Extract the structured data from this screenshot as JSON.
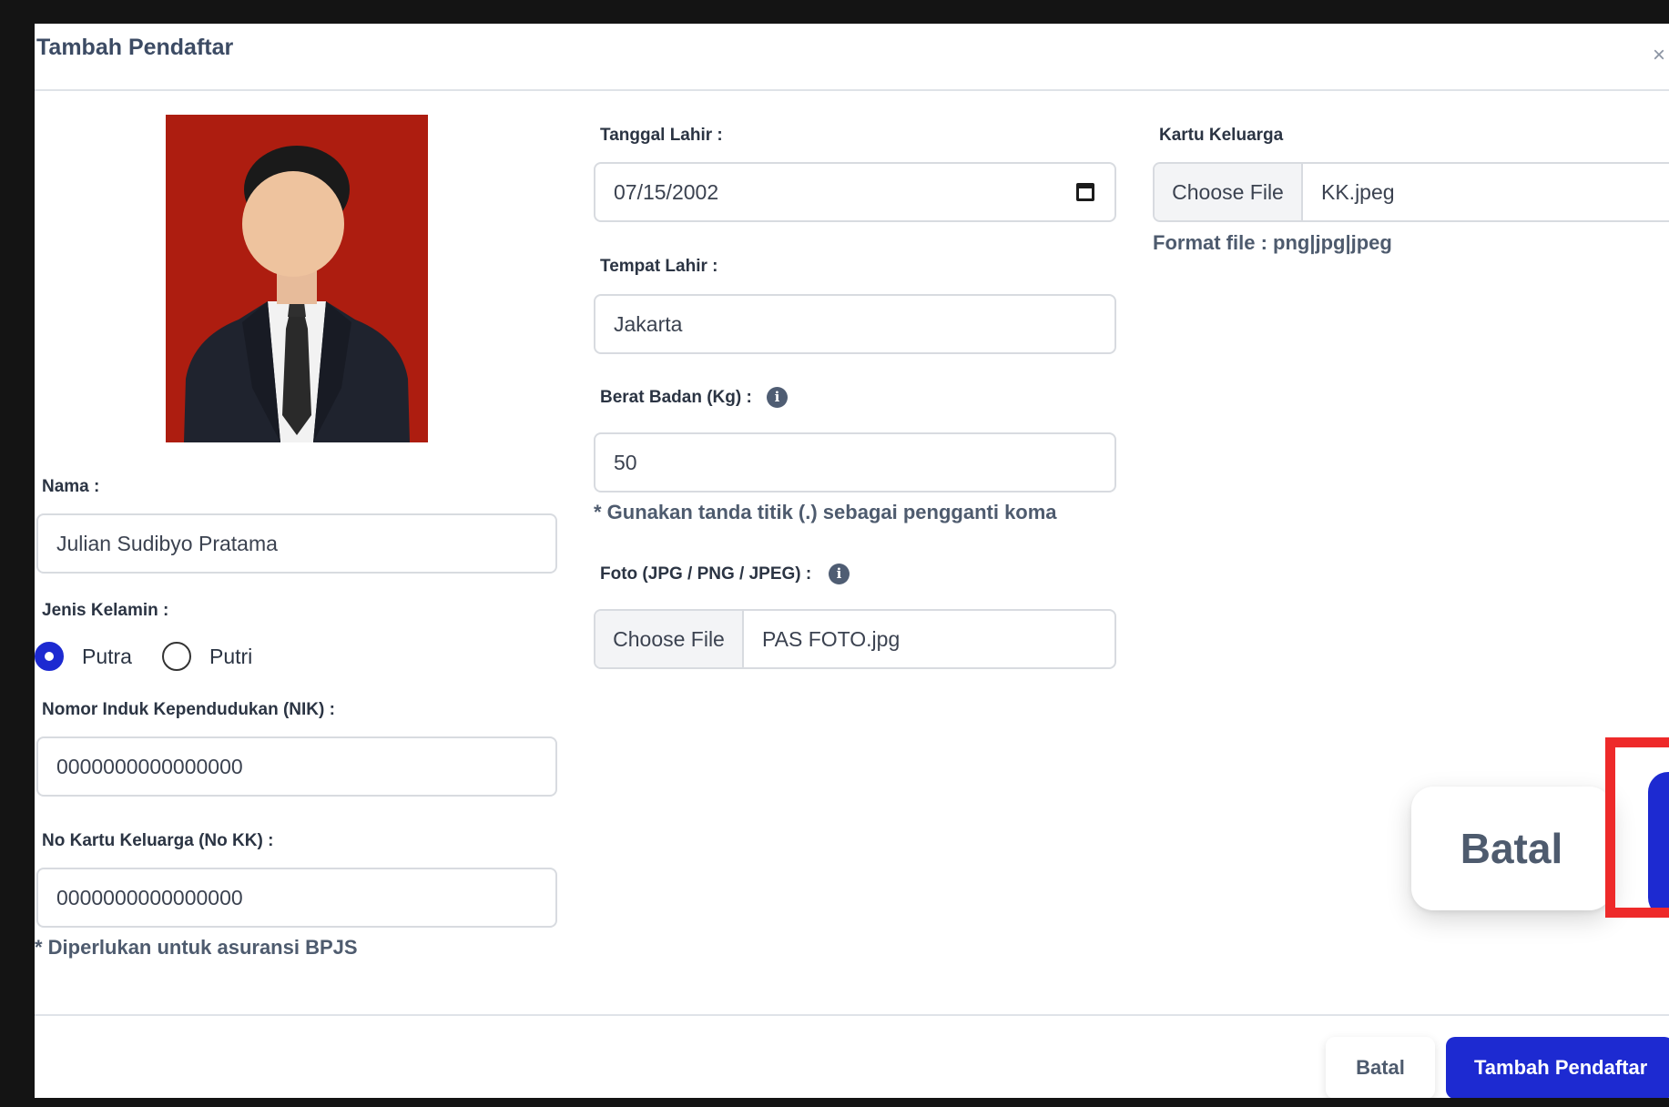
{
  "modal": {
    "title": "Tambah Pendaftar",
    "close_icon": "×"
  },
  "left": {
    "photo_alt": "pas-foto",
    "nama_label": "Nama :",
    "nama_value": "Julian Sudibyo Pratama",
    "gender_label": "Jenis Kelamin :",
    "gender_options": [
      "Putra",
      "Putri"
    ],
    "gender_selected": "Putra",
    "nik_label": "Nomor Induk Kependudukan (NIK) :",
    "nik_value": "0000000000000000",
    "kk_label": "No Kartu Keluarga (No KK) :",
    "kk_value": "0000000000000000",
    "kk_note": "* Diperlukan untuk asuransi BPJS"
  },
  "middle": {
    "tanggal_label": "Tanggal Lahir :",
    "tanggal_value": "07/15/2002",
    "tempat_label": "Tempat Lahir :",
    "tempat_value": "Jakarta",
    "berat_label": "Berat Badan (Kg) :",
    "berat_value": "50",
    "berat_note": "* Gunakan tanda titik (.) sebagai pengganti koma",
    "foto_label": "Foto (JPG / PNG / JPEG) :",
    "foto_button": "Choose File",
    "foto_file": "PAS FOTO.jpg"
  },
  "right": {
    "kk_file_label": "Kartu Keluarga",
    "kk_file_button": "Choose File",
    "kk_file_name": "KK.jpeg",
    "format_note": "Format file : png|jpg|jpeg"
  },
  "zoom": {
    "batal_label": "Batal"
  },
  "footer": {
    "batal_label": "Batal",
    "submit_label": "Tambah Pendaftar"
  },
  "icons": {
    "info": "i",
    "calendar": "calendar-icon"
  },
  "colors": {
    "primary": "#1d2ad1",
    "highlight": "#ee2a2a",
    "photo_background": "#ad1d10",
    "text_dark": "#2b3443",
    "text_muted": "#4e5b6e"
  }
}
